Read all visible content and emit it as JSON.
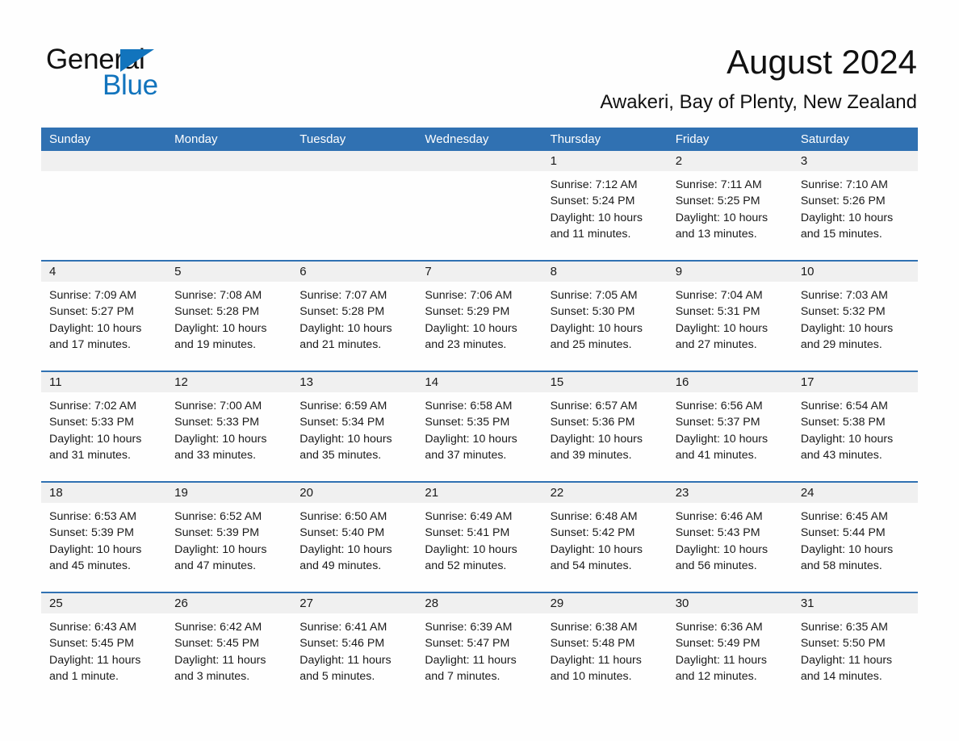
{
  "brand": {
    "name_part1": "General",
    "name_part2": "Blue",
    "triangle_icon": "triangle-icon",
    "accent_color": "#1274bd"
  },
  "header": {
    "month_title": "August 2024",
    "location": "Awakeri, Bay of Plenty, New Zealand"
  },
  "theme": {
    "header_blue": "#3071b2",
    "daynum_band": "#f0f0f0",
    "text": "#1a1a1a"
  },
  "weekdays": [
    "Sunday",
    "Monday",
    "Tuesday",
    "Wednesday",
    "Thursday",
    "Friday",
    "Saturday"
  ],
  "weeks": [
    [
      {
        "day": "",
        "lines": []
      },
      {
        "day": "",
        "lines": []
      },
      {
        "day": "",
        "lines": []
      },
      {
        "day": "",
        "lines": []
      },
      {
        "day": "1",
        "lines": [
          "Sunrise: 7:12 AM",
          "Sunset: 5:24 PM",
          "Daylight: 10 hours",
          "and 11 minutes."
        ]
      },
      {
        "day": "2",
        "lines": [
          "Sunrise: 7:11 AM",
          "Sunset: 5:25 PM",
          "Daylight: 10 hours",
          "and 13 minutes."
        ]
      },
      {
        "day": "3",
        "lines": [
          "Sunrise: 7:10 AM",
          "Sunset: 5:26 PM",
          "Daylight: 10 hours",
          "and 15 minutes."
        ]
      }
    ],
    [
      {
        "day": "4",
        "lines": [
          "Sunrise: 7:09 AM",
          "Sunset: 5:27 PM",
          "Daylight: 10 hours",
          "and 17 minutes."
        ]
      },
      {
        "day": "5",
        "lines": [
          "Sunrise: 7:08 AM",
          "Sunset: 5:28 PM",
          "Daylight: 10 hours",
          "and 19 minutes."
        ]
      },
      {
        "day": "6",
        "lines": [
          "Sunrise: 7:07 AM",
          "Sunset: 5:28 PM",
          "Daylight: 10 hours",
          "and 21 minutes."
        ]
      },
      {
        "day": "7",
        "lines": [
          "Sunrise: 7:06 AM",
          "Sunset: 5:29 PM",
          "Daylight: 10 hours",
          "and 23 minutes."
        ]
      },
      {
        "day": "8",
        "lines": [
          "Sunrise: 7:05 AM",
          "Sunset: 5:30 PM",
          "Daylight: 10 hours",
          "and 25 minutes."
        ]
      },
      {
        "day": "9",
        "lines": [
          "Sunrise: 7:04 AM",
          "Sunset: 5:31 PM",
          "Daylight: 10 hours",
          "and 27 minutes."
        ]
      },
      {
        "day": "10",
        "lines": [
          "Sunrise: 7:03 AM",
          "Sunset: 5:32 PM",
          "Daylight: 10 hours",
          "and 29 minutes."
        ]
      }
    ],
    [
      {
        "day": "11",
        "lines": [
          "Sunrise: 7:02 AM",
          "Sunset: 5:33 PM",
          "Daylight: 10 hours",
          "and 31 minutes."
        ]
      },
      {
        "day": "12",
        "lines": [
          "Sunrise: 7:00 AM",
          "Sunset: 5:33 PM",
          "Daylight: 10 hours",
          "and 33 minutes."
        ]
      },
      {
        "day": "13",
        "lines": [
          "Sunrise: 6:59 AM",
          "Sunset: 5:34 PM",
          "Daylight: 10 hours",
          "and 35 minutes."
        ]
      },
      {
        "day": "14",
        "lines": [
          "Sunrise: 6:58 AM",
          "Sunset: 5:35 PM",
          "Daylight: 10 hours",
          "and 37 minutes."
        ]
      },
      {
        "day": "15",
        "lines": [
          "Sunrise: 6:57 AM",
          "Sunset: 5:36 PM",
          "Daylight: 10 hours",
          "and 39 minutes."
        ]
      },
      {
        "day": "16",
        "lines": [
          "Sunrise: 6:56 AM",
          "Sunset: 5:37 PM",
          "Daylight: 10 hours",
          "and 41 minutes."
        ]
      },
      {
        "day": "17",
        "lines": [
          "Sunrise: 6:54 AM",
          "Sunset: 5:38 PM",
          "Daylight: 10 hours",
          "and 43 minutes."
        ]
      }
    ],
    [
      {
        "day": "18",
        "lines": [
          "Sunrise: 6:53 AM",
          "Sunset: 5:39 PM",
          "Daylight: 10 hours",
          "and 45 minutes."
        ]
      },
      {
        "day": "19",
        "lines": [
          "Sunrise: 6:52 AM",
          "Sunset: 5:39 PM",
          "Daylight: 10 hours",
          "and 47 minutes."
        ]
      },
      {
        "day": "20",
        "lines": [
          "Sunrise: 6:50 AM",
          "Sunset: 5:40 PM",
          "Daylight: 10 hours",
          "and 49 minutes."
        ]
      },
      {
        "day": "21",
        "lines": [
          "Sunrise: 6:49 AM",
          "Sunset: 5:41 PM",
          "Daylight: 10 hours",
          "and 52 minutes."
        ]
      },
      {
        "day": "22",
        "lines": [
          "Sunrise: 6:48 AM",
          "Sunset: 5:42 PM",
          "Daylight: 10 hours",
          "and 54 minutes."
        ]
      },
      {
        "day": "23",
        "lines": [
          "Sunrise: 6:46 AM",
          "Sunset: 5:43 PM",
          "Daylight: 10 hours",
          "and 56 minutes."
        ]
      },
      {
        "day": "24",
        "lines": [
          "Sunrise: 6:45 AM",
          "Sunset: 5:44 PM",
          "Daylight: 10 hours",
          "and 58 minutes."
        ]
      }
    ],
    [
      {
        "day": "25",
        "lines": [
          "Sunrise: 6:43 AM",
          "Sunset: 5:45 PM",
          "Daylight: 11 hours",
          "and 1 minute."
        ]
      },
      {
        "day": "26",
        "lines": [
          "Sunrise: 6:42 AM",
          "Sunset: 5:45 PM",
          "Daylight: 11 hours",
          "and 3 minutes."
        ]
      },
      {
        "day": "27",
        "lines": [
          "Sunrise: 6:41 AM",
          "Sunset: 5:46 PM",
          "Daylight: 11 hours",
          "and 5 minutes."
        ]
      },
      {
        "day": "28",
        "lines": [
          "Sunrise: 6:39 AM",
          "Sunset: 5:47 PM",
          "Daylight: 11 hours",
          "and 7 minutes."
        ]
      },
      {
        "day": "29",
        "lines": [
          "Sunrise: 6:38 AM",
          "Sunset: 5:48 PM",
          "Daylight: 11 hours",
          "and 10 minutes."
        ]
      },
      {
        "day": "30",
        "lines": [
          "Sunrise: 6:36 AM",
          "Sunset: 5:49 PM",
          "Daylight: 11 hours",
          "and 12 minutes."
        ]
      },
      {
        "day": "31",
        "lines": [
          "Sunrise: 6:35 AM",
          "Sunset: 5:50 PM",
          "Daylight: 11 hours",
          "and 14 minutes."
        ]
      }
    ]
  ]
}
